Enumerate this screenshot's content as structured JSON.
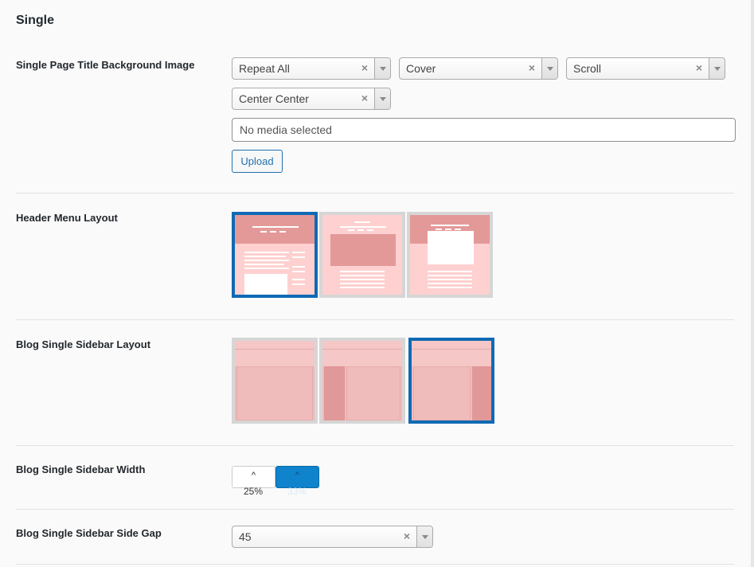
{
  "section": {
    "title": "Single"
  },
  "title_bg": {
    "label": "Single Page Title Background Image",
    "repeat": "Repeat All",
    "size": "Cover",
    "attachment": "Scroll",
    "position": "Center Center",
    "clear_glyph": "×",
    "media_text": "No media selected",
    "upload_label": "Upload"
  },
  "header_menu": {
    "label": "Header Menu Layout",
    "options": [
      "layout-1",
      "layout-2",
      "layout-3"
    ],
    "selected": 0
  },
  "sidebar_layout": {
    "label": "Blog Single Sidebar Layout",
    "options": [
      "no-sidebar",
      "left-sidebar",
      "right-sidebar"
    ],
    "selected": 2
  },
  "sidebar_width": {
    "label": "Blog Single Sidebar Width",
    "options": [
      "25%",
      "33%"
    ],
    "selected": 1,
    "caret": "^"
  },
  "side_gap": {
    "label": "Blog Single Sidebar Side Gap",
    "value": "45"
  },
  "colors": {
    "accent": "#0f6ab4",
    "thumb_bg": "#ffd0d0",
    "thumb_dark": "#e49999"
  }
}
